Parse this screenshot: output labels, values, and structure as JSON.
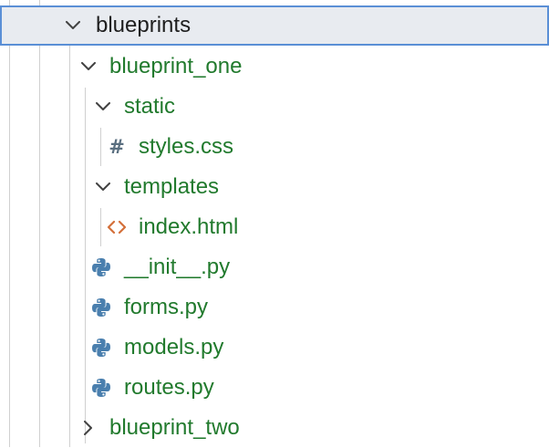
{
  "explorer": {
    "root_folder": {
      "name": "blueprints",
      "expanded": true,
      "selected": true
    },
    "blueprint_one": {
      "name": "blueprint_one",
      "expanded": true
    },
    "static_folder": {
      "name": "static",
      "expanded": true
    },
    "styles_file": {
      "name": "styles.css",
      "icon": "hash-icon",
      "icon_glyph": "#"
    },
    "templates_folder": {
      "name": "templates",
      "expanded": true
    },
    "index_file": {
      "name": "index.html",
      "icon": "html-code-icon"
    },
    "python_files": [
      {
        "name": "__init__.py",
        "icon": "python-icon"
      },
      {
        "name": "forms.py",
        "icon": "python-icon"
      },
      {
        "name": "models.py",
        "icon": "python-icon"
      },
      {
        "name": "routes.py",
        "icon": "python-icon"
      }
    ],
    "blueprint_two": {
      "name": "blueprint_two",
      "expanded": false
    }
  },
  "colors": {
    "label_green": "#217a2d",
    "selected_background": "#e8ebf0",
    "selected_border": "#5a8fd6",
    "guide_line": "#d0d0d0",
    "python_icon": "#4a7fae",
    "html_icon": "#d4703a",
    "css_hash_icon": "#5a6f80"
  }
}
